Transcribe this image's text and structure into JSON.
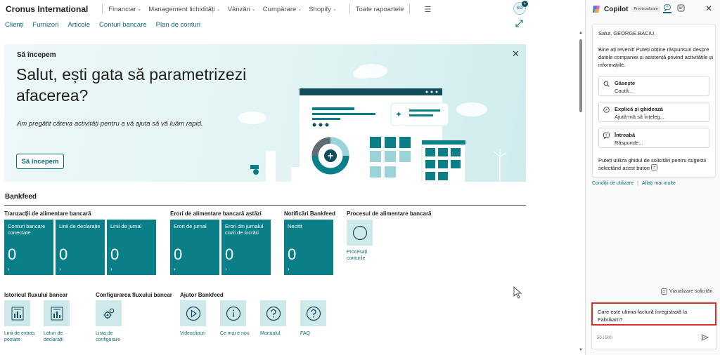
{
  "header": {
    "company": "Cronus International",
    "menus": [
      {
        "label": "Financiar"
      },
      {
        "label": "Management lichidități"
      },
      {
        "label": "Vânzări"
      },
      {
        "label": "Cumpărare"
      },
      {
        "label": "Shopify"
      }
    ],
    "reports": "Toate rapoartele",
    "user_initials": "SO"
  },
  "nav": {
    "links": [
      "Clienți",
      "Furnizori",
      "Articole",
      "Conturi bancare",
      "Plan de conturi"
    ]
  },
  "banner": {
    "kicker": "Să începem",
    "title": "Salut, ești gata să parametrizezi afacerea?",
    "subtitle": "Am pregătit câteva activități pentru a vă ajuta să vă luăm rapid.",
    "button": "Să începem"
  },
  "section": {
    "title": "Bankfeed"
  },
  "groups": {
    "tranzactii": "Tranzacții de alimentare bancară",
    "erori": "Erori de alimentare bancară astăzi",
    "notificari": "Notificări Bankfeed",
    "proces": "Procesul de alimentare bancară",
    "istoric": "Istoricul fluxului bancar",
    "configurare": "Configurarea fluxului bancar",
    "ajutor": "Ajutor Bankfeed"
  },
  "tiles": [
    {
      "label": "Conturi bancare conectate",
      "value": "0"
    },
    {
      "label": "Linii de declarație",
      "value": "0"
    },
    {
      "label": "Linii de jurnal",
      "value": "0"
    },
    {
      "label": "Erori de jurnal",
      "value": "0"
    },
    {
      "label": "Erori din jurnalul cozii de lucrări",
      "value": "0"
    },
    {
      "label": "Necitit",
      "value": "0"
    }
  ],
  "actions": {
    "procesati": "Procesați conturile",
    "linii_extras": "Linii de extras postate",
    "loturi": "Loturi de declarații",
    "lista_config": "Lista de configurare",
    "videoclipuri": "Videoclipuri",
    "ce_mai_nou": "Ce mai e nou",
    "manualul": "Manualul",
    "faq": "FAQ"
  },
  "copilot": {
    "title": "Copilot",
    "badge": "Previzualizare",
    "greeting": "Salut, GEORGE.BACIU.",
    "intro": "Bine ați revenit! Puteți obține răspunsuri despre datele companiei și asistență privind activitățile și informațiile.",
    "options": [
      {
        "title": "Găsește",
        "sub": "Caută..."
      },
      {
        "title": "Explică și ghidează",
        "sub": "Ajută-mă să înțeleg..."
      },
      {
        "title": "Întreabă",
        "sub": "Răspunde..."
      }
    ],
    "tip": "Puteți utiliza ghidul de solicitări pentru sugestii selectând acest buton",
    "terms": "Condiții de utilizare",
    "learn": "Aflați mai multe",
    "view_prompts": "Vizualizare solicitări",
    "input_text": "Care este ultima factură înregistrată la Fabrikam?",
    "counter": "50 / 500"
  }
}
